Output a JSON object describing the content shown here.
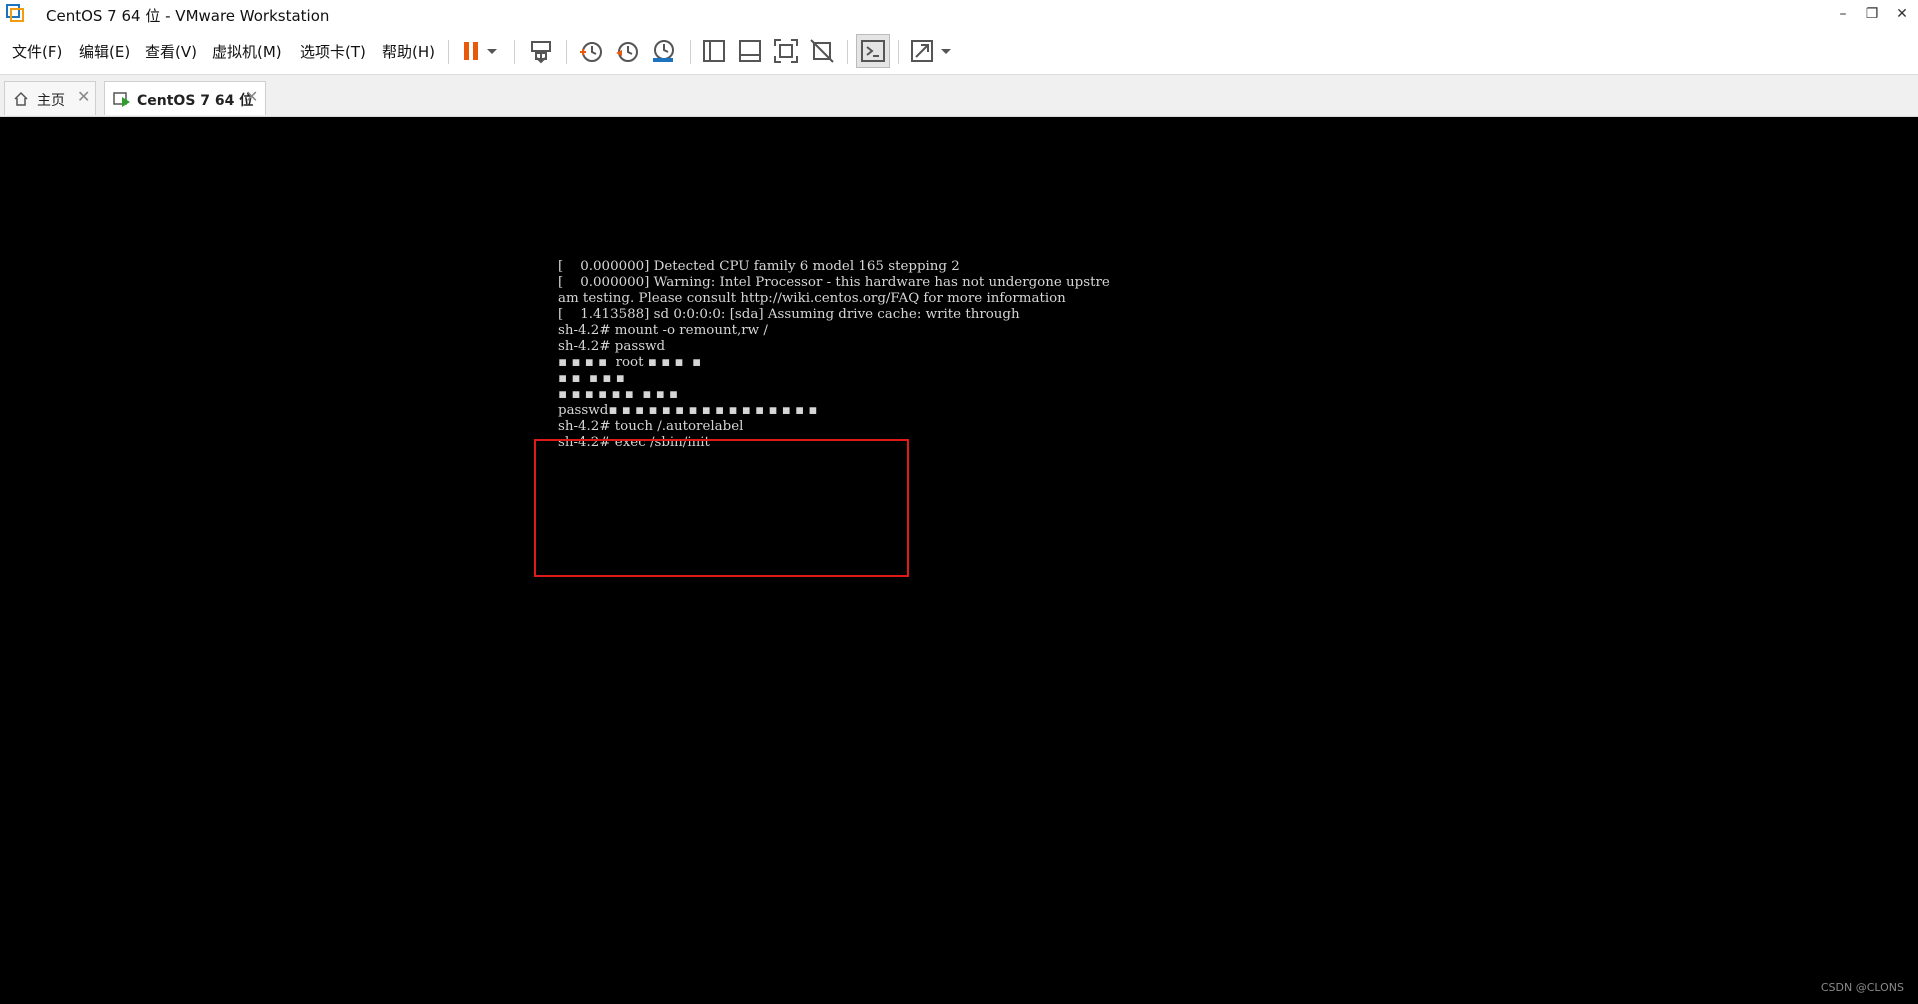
{
  "window": {
    "title": "CentOS 7 64 位 - VMware Workstation",
    "controls": {
      "minimize": "–",
      "restore": "❐",
      "close": "✕"
    }
  },
  "menu": {
    "items": [
      "文件(F)",
      "编辑(E)",
      "查看(V)",
      "虚拟机(M)",
      "选项卡(T)",
      "帮助(H)"
    ]
  },
  "toolbar": {
    "icons": [
      "pause-icon",
      "dropdown-arrow-icon",
      "send-ctrl-alt-del-icon",
      "snapshot-icon",
      "revert-snapshot-icon",
      "snapshot-manager-icon",
      "show-library-icon",
      "show-thumbnail-icon",
      "fit-guest-icon",
      "stretch-guest-icon",
      "console-view-icon",
      "fullscreen-icon",
      "dropdown-arrow-icon"
    ],
    "accent_color": "#e8590c"
  },
  "tabs": [
    {
      "label": "主页",
      "icon": "home-icon",
      "active": false
    },
    {
      "label": "CentOS 7 64 位",
      "icon": "vm-running-icon",
      "active": true
    }
  ],
  "console": {
    "lines": [
      "[    0.000000] Detected CPU family 6 model 165 stepping 2",
      "[    0.000000] Warning: Intel Processor - this hardware has not undergone upstre",
      "am testing. Please consult http://wiki.centos.org/FAQ for more information",
      "[    1.413588] sd 0:0:0:0: [sda] Assuming drive cache: write through",
      "sh-4.2# mount -o remount,rw /",
      "sh-4.2# passwd",
      "▪ ▪ ▪ ▪  root ▪ ▪ ▪  ▪",
      "▪ ▪  ▪ ▪ ▪",
      "▪ ▪ ▪ ▪ ▪ ▪  ▪ ▪ ▪",
      "passwd▪ ▪ ▪ ▪ ▪ ▪ ▪ ▪ ▪ ▪ ▪ ▪ ▪ ▪ ▪ ▪",
      "sh-4.2# touch /.autorelabel",
      "sh-4.2# exec /sbin/init"
    ],
    "text_color": "#d6d6d6",
    "highlight_color": "#e01919"
  },
  "watermark": "CSDN @CLONS"
}
